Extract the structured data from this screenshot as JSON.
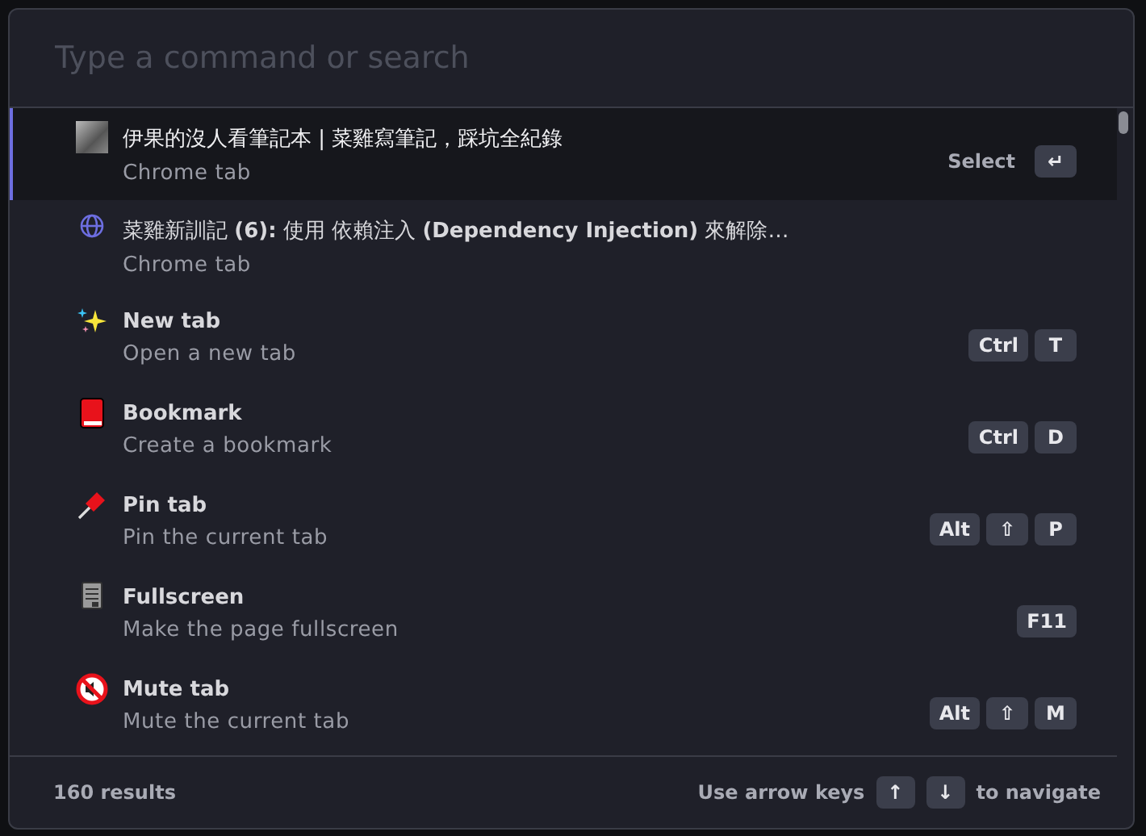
{
  "search": {
    "placeholder": "Type a command or search"
  },
  "items": [
    {
      "kind": "thumbnail",
      "title": "伊果的沒人看筆記本 | 菜雞寫筆記，踩坑全紀錄",
      "subtitle": "Chrome tab",
      "selected": true,
      "hint": "Select",
      "keys": [
        "↵"
      ]
    },
    {
      "kind": "globe",
      "title": "菜雞新訓記 **(6):** 使用 依賴注入 **(Dependency Injection)** 來解除…",
      "subtitle": "Chrome tab",
      "selected": false
    },
    {
      "kind": "sparkles",
      "title": "New tab",
      "subtitle": "Open a new tab",
      "selected": false,
      "keys": [
        "Ctrl",
        "T"
      ]
    },
    {
      "kind": "book",
      "title": "Bookmark",
      "subtitle": "Create a bookmark",
      "selected": false,
      "keys": [
        "Ctrl",
        "D"
      ]
    },
    {
      "kind": "pin",
      "title": "Pin tab",
      "subtitle": "Pin the current tab",
      "selected": false,
      "keys": [
        "Alt",
        "⇧",
        "P"
      ]
    },
    {
      "kind": "document",
      "title": "Fullscreen",
      "subtitle": "Make the page fullscreen",
      "selected": false,
      "keys": [
        "F11"
      ]
    },
    {
      "kind": "mute",
      "title": "Mute tab",
      "subtitle": "Mute the current tab",
      "selected": false,
      "keys": [
        "Alt",
        "⇧",
        "M"
      ]
    }
  ],
  "footer": {
    "count": "160 results",
    "hint_before": "Use arrow keys",
    "keys": [
      "↑",
      "↓"
    ],
    "hint_after": "to navigate"
  }
}
